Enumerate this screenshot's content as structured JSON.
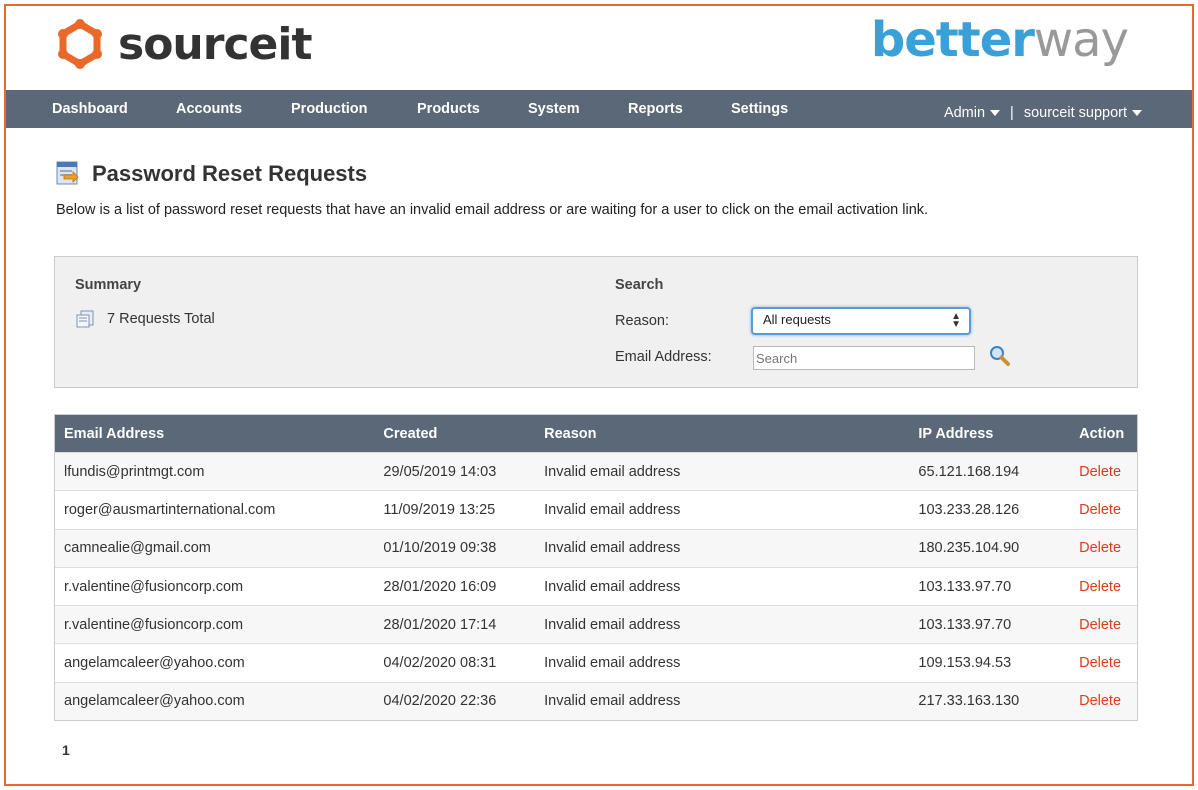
{
  "brand": {
    "left_logo_text": "sourceit",
    "right_logo_part1": "better",
    "right_logo_part2": "way",
    "accent": "#e8692a",
    "nav_bg": "#5a6877",
    "delete_color": "#e03a1e"
  },
  "nav": {
    "items": [
      "Dashboard",
      "Accounts",
      "Production",
      "Products",
      "System",
      "Reports",
      "Settings"
    ],
    "admin_label": "Admin",
    "separator": "|",
    "support_label": "sourceit support"
  },
  "page": {
    "title": "Password Reset Requests",
    "description": "Below is a list of password reset requests that have an invalid email address or are waiting for a user to click on the email activation link."
  },
  "summary": {
    "heading": "Summary",
    "total_text": "7 Requests Total"
  },
  "search": {
    "heading": "Search",
    "reason_label": "Reason:",
    "reason_selected": "All requests",
    "email_label": "Email Address:",
    "email_placeholder": "Search"
  },
  "table": {
    "headers": [
      "Email Address",
      "Created",
      "Reason",
      "IP Address",
      "Action"
    ],
    "rows": [
      {
        "email": "lfundis@printmgt.com",
        "created": "29/05/2019 14:03",
        "reason": "Invalid email address",
        "ip": "65.121.168.194",
        "action": "Delete"
      },
      {
        "email": "roger@ausmartinternational.com",
        "created": "11/09/2019 13:25",
        "reason": "Invalid email address",
        "ip": "103.233.28.126",
        "action": "Delete"
      },
      {
        "email": "camnealie@gmail.com",
        "created": "01/10/2019 09:38",
        "reason": "Invalid email address",
        "ip": "180.235.104.90",
        "action": "Delete"
      },
      {
        "email": "r.valentine@fusioncorp.com",
        "created": "28/01/2020 16:09",
        "reason": "Invalid email address",
        "ip": "103.133.97.70",
        "action": "Delete"
      },
      {
        "email": "r.valentine@fusioncorp.com",
        "created": "28/01/2020 17:14",
        "reason": "Invalid email address",
        "ip": "103.133.97.70",
        "action": "Delete"
      },
      {
        "email": "angelamcaleer@yahoo.com",
        "created": "04/02/2020 08:31",
        "reason": "Invalid email address",
        "ip": "109.153.94.53",
        "action": "Delete"
      },
      {
        "email": "angelamcaleer@yahoo.com",
        "created": "04/02/2020 22:36",
        "reason": "Invalid email address",
        "ip": "217.33.163.130",
        "action": "Delete"
      }
    ]
  },
  "pagination": {
    "current_page": "1"
  }
}
